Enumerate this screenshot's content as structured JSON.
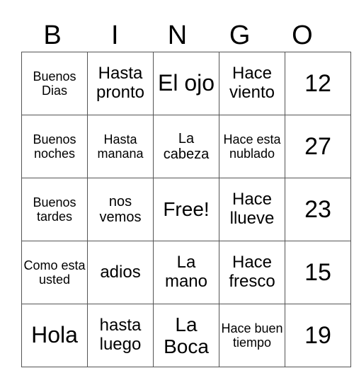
{
  "header": [
    "B",
    "I",
    "N",
    "G",
    "O"
  ],
  "rows": [
    [
      "Buenos Dias",
      "Hasta pronto",
      "El ojo",
      "Hace viento",
      "12"
    ],
    [
      "Buenos noches",
      "Hasta manana",
      "La cabeza",
      "Hace esta nublado",
      "27"
    ],
    [
      "Buenos tardes",
      "nos vemos",
      "Free!",
      "Hace llueve",
      "23"
    ],
    [
      "Como esta usted",
      "adios",
      "La mano",
      "Hace fresco",
      "15"
    ],
    [
      "Hola",
      "hasta luego",
      "La Boca",
      "Hace buen tiempo",
      "19"
    ]
  ]
}
